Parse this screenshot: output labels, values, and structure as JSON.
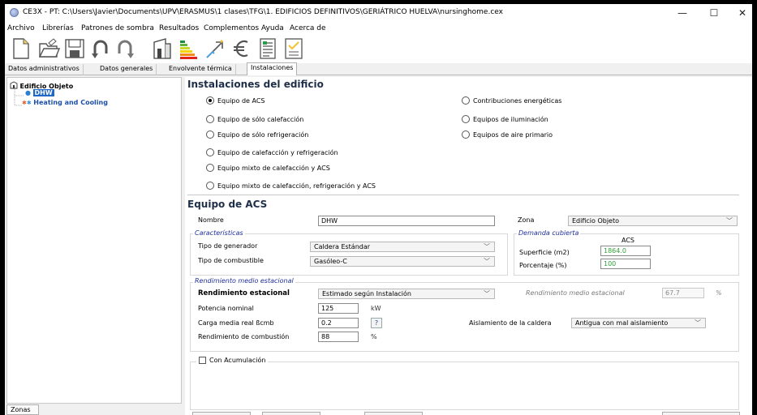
{
  "window": {
    "title": "CE3X - PT: C:\\Users\\Javier\\Documents\\UPV\\ERASMUS\\1 clases\\TFG\\1. EDIFICIOS DEFINITIVOS\\GERIÁTRICO HUELVA\\nursinghome.cex",
    "minimize": "—",
    "maximize": "☐",
    "close": "✕"
  },
  "menu": [
    "Archivo",
    "Librerías",
    "Patrones de sombra",
    "Resultados",
    "Complementos",
    "Ayuda",
    "Acerca de"
  ],
  "tabs": [
    "Datos administrativos",
    "Datos generales",
    "Envolvente térmica",
    "Instalaciones"
  ],
  "active_tab": "Instalaciones",
  "tree": {
    "root": "Edificio Objeto",
    "children": [
      "DHW",
      "Heating and Cooling"
    ]
  },
  "bottom_tab": "Zonas",
  "instalaciones": {
    "heading": "Instalaciones del edificio",
    "options_left": [
      "Equipo de ACS",
      "Equipo de sólo calefacción",
      "Equipo de sólo refrigeración",
      "Equipo de calefacción y refrigeración",
      "Equipo mixto de calefacción y ACS",
      "Equipo mixto de calefacción, refrigeración y ACS"
    ],
    "options_right": [
      "Contribuciones energéticas",
      "Equipos de iluminación",
      "Equipos de aire primario"
    ]
  },
  "equipo": {
    "heading": "Equipo de ACS",
    "nombre_label": "Nombre",
    "nombre_value": "DHW",
    "zona_label": "Zona",
    "zona_value": "Edificio Objeto",
    "caracteristicas_label": "Características",
    "tipo_generador_label": "Tipo de generador",
    "tipo_generador_value": "Caldera Estándar",
    "tipo_combustible_label": "Tipo de combustible",
    "tipo_combustible_value": "Gasóleo-C",
    "demanda_label": "Demanda cubierta",
    "acs_label": "ACS",
    "superficie_label": "Superficie (m2)",
    "superficie_value": "1864.0",
    "porcentaje_label": "Porcentaje (%)",
    "porcentaje_value": "100"
  },
  "rendimiento": {
    "group_label": "Rendimiento medio estacional",
    "rend_label": "Rendimiento estacional",
    "rend_value": "Estimado según Instalación",
    "rend_medio_label": "Rendimiento medio estacional",
    "rend_medio_value": "67.7",
    "rend_medio_unit": "%",
    "potencia_label": "Potencia nominal",
    "potencia_value": "125",
    "potencia_unit": "kW",
    "carga_label": "Carga media real ßcmb",
    "carga_value": "0.2",
    "carga_help": "?",
    "aislamiento_label": "Aislamiento de la caldera",
    "aislamiento_value": "Antigua con mal aislamiento",
    "combustion_label": "Rendimiento de combustión",
    "combustion_value": "88",
    "combustion_unit": "%"
  },
  "acumulacion": {
    "label": "Con Acumulación"
  }
}
